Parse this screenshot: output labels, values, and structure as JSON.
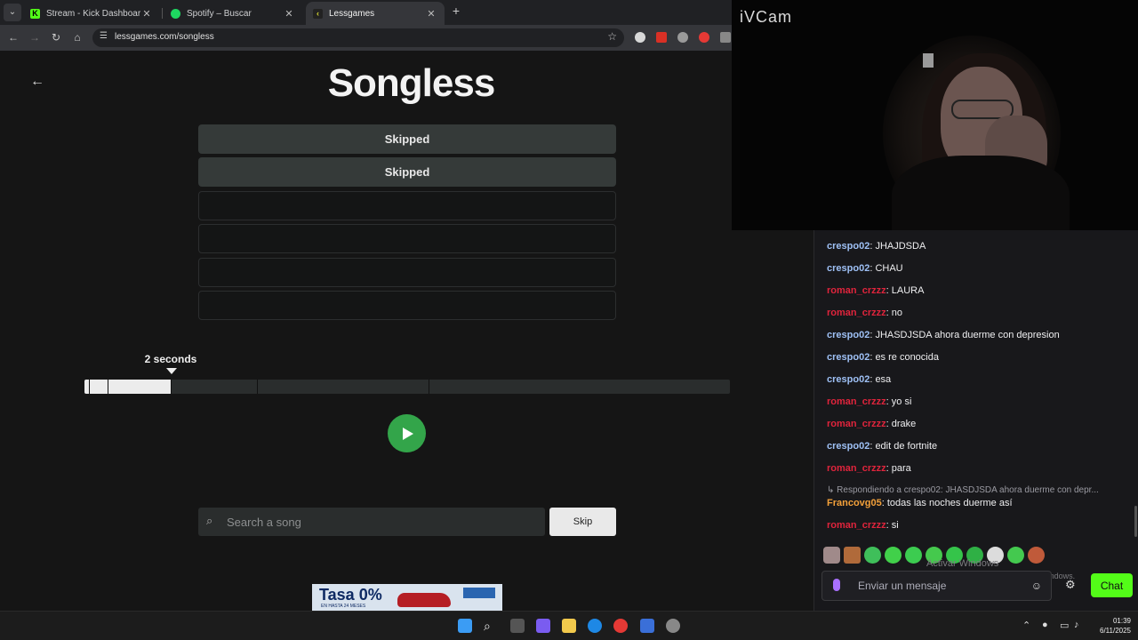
{
  "browser": {
    "tabs": [
      {
        "label": "Stream - Kick Dashboard",
        "icon": "kick-icon",
        "active": false
      },
      {
        "label": "Spotify – Buscar",
        "icon": "spotify-icon",
        "active": false
      },
      {
        "label": "Lessgames",
        "icon": "lessgames-icon",
        "active": true
      }
    ],
    "url": "lessgames.com/songless"
  },
  "game": {
    "logo": "Songless",
    "guesses": [
      "Skipped",
      "Skipped",
      "",
      "",
      "",
      ""
    ],
    "seconds_label": "2 seconds",
    "progress_fraction": 0.134,
    "search_placeholder": "Search a song",
    "skip_label": "Skip"
  },
  "ad": {
    "headline": "Tasa 0%",
    "subline": "EN HASTA 24 MESES"
  },
  "webcam": {
    "title": "iVCam"
  },
  "chat": {
    "messages": [
      {
        "user": "crespo02",
        "text": "JHAJDSDA",
        "color": "#9ec0f5"
      },
      {
        "user": "crespo02",
        "text": "CHAU",
        "color": "#9ec0f5"
      },
      {
        "user": "roman_crzzz",
        "text": "LAURA",
        "color": "#e0243c"
      },
      {
        "user": "roman_crzzz",
        "text": "no",
        "color": "#e0243c"
      },
      {
        "user": "crespo02",
        "text": "JHASDJSDA ahora duerme con depresion",
        "color": "#9ec0f5"
      },
      {
        "user": "crespo02",
        "text": "es re conocida",
        "color": "#9ec0f5"
      },
      {
        "user": "crespo02",
        "text": "esa",
        "color": "#9ec0f5"
      },
      {
        "user": "roman_crzzz",
        "text": "yo si",
        "color": "#e0243c"
      },
      {
        "user": "roman_crzzz",
        "text": "drake",
        "color": "#e0243c"
      },
      {
        "user": "crespo02",
        "text": "edit de fortnite",
        "color": "#9ec0f5"
      },
      {
        "user": "roman_crzzz",
        "text": "para",
        "color": "#e0243c"
      }
    ],
    "reply_context": "↳ Respondiendo a crespo02: JHASDJSDA ahora duerme con depr...",
    "reply_message": {
      "user": "Francovg05",
      "text": "todas las noches duerme así",
      "color": "#f4a13a"
    },
    "last_message": {
      "user": "roman_crzzz",
      "text": "si",
      "color": "#e0243c"
    },
    "activate_line1": "Activar Windows",
    "activate_line2": "Ve a Configuración para activar Windows.",
    "input_placeholder": "Enviar un mensaje",
    "send_label": "Chat"
  },
  "taskbar": {
    "time": "01:39",
    "date": "6/11/2025"
  }
}
